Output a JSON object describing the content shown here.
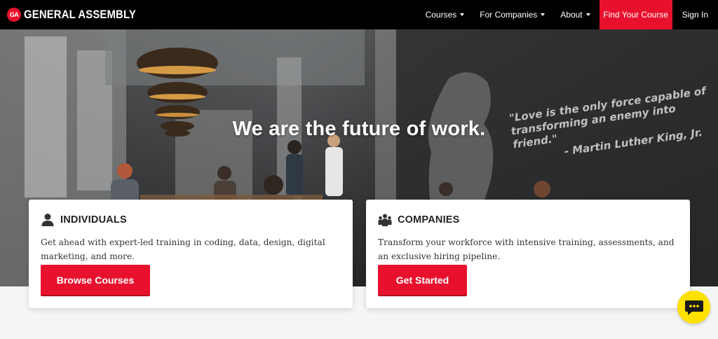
{
  "brand": {
    "badge": "GA",
    "name": "GENERAL ASSEMBLY",
    "accent": "#e8112d"
  },
  "nav": {
    "items": [
      {
        "label": "Courses",
        "dropdown": true
      },
      {
        "label": "For Companies",
        "dropdown": true
      },
      {
        "label": "About",
        "dropdown": true
      }
    ],
    "cta": "Find Your Course",
    "signin": "Sign In"
  },
  "hero": {
    "title": "We are the future of work.",
    "quote_lines": [
      "\"Love is the only force capable of",
      "transforming an enemy into friend.\""
    ],
    "quote_author": "- Martin Luther King, Jr."
  },
  "cards": {
    "individuals": {
      "icon": "person-icon",
      "title": "INDIVIDUALS",
      "text": "Get ahead with expert-led training in coding, data, design, digital marketing, and more.",
      "button": "Browse Courses"
    },
    "companies": {
      "icon": "group-icon",
      "title": "COMPANIES",
      "text": "Transform your workforce with intensive training, assessments, and an exclusive hiring pipeline.",
      "button": "Get Started"
    }
  },
  "chat": {
    "icon": "chat-icon",
    "color": "#ffe100"
  }
}
